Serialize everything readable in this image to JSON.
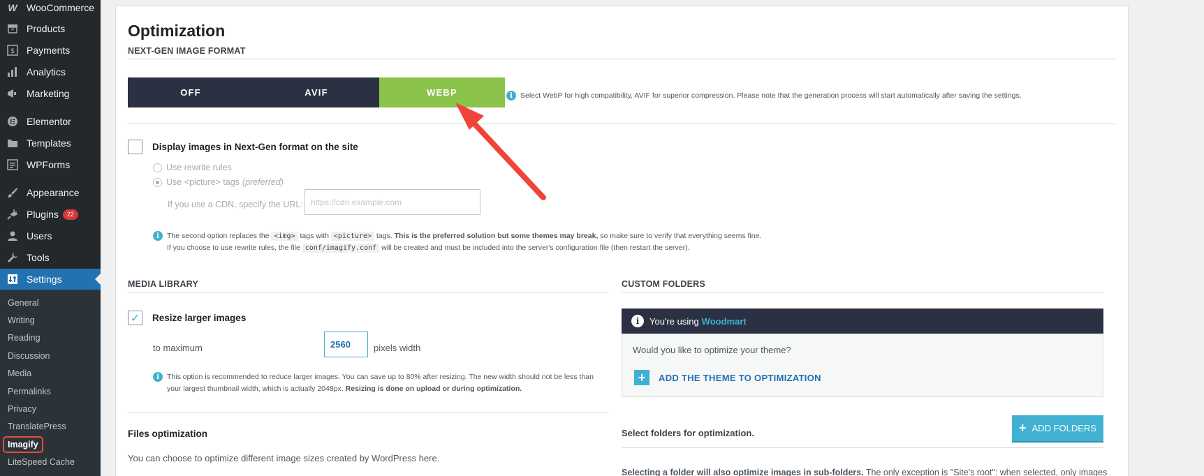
{
  "sidebar": {
    "items": [
      {
        "label": "WooCommerce",
        "icon": "woo-icon",
        "badge": ""
      },
      {
        "label": "Products",
        "icon": "archive-icon",
        "badge": ""
      },
      {
        "label": "Payments",
        "icon": "dollar-icon",
        "badge": ""
      },
      {
        "label": "Analytics",
        "icon": "bar-chart-icon",
        "badge": ""
      },
      {
        "label": "Marketing",
        "icon": "megaphone-icon",
        "badge": ""
      },
      {
        "label": "Elementor",
        "icon": "elementor-icon",
        "badge": ""
      },
      {
        "label": "Templates",
        "icon": "folder-icon",
        "badge": ""
      },
      {
        "label": "WPForms",
        "icon": "forms-icon",
        "badge": ""
      },
      {
        "label": "Appearance",
        "icon": "brush-icon",
        "badge": ""
      },
      {
        "label": "Plugins",
        "icon": "plug-icon",
        "badge": "22"
      },
      {
        "label": "Users",
        "icon": "user-icon",
        "badge": ""
      },
      {
        "label": "Tools",
        "icon": "wrench-icon",
        "badge": ""
      },
      {
        "label": "Settings",
        "icon": "settings-icon",
        "badge": ""
      }
    ],
    "submenu": [
      "General",
      "Writing",
      "Reading",
      "Discussion",
      "Media",
      "Permalinks",
      "Privacy",
      "TranslatePress",
      "Imagify",
      "LiteSpeed Cache"
    ]
  },
  "page": {
    "title": "Optimization",
    "nextgen_label": "NEXT-GEN IMAGE FORMAT",
    "format_options": [
      "OFF",
      "AVIF",
      "WEBP"
    ],
    "format_selected": "WEBP",
    "format_help": "Select WebP for high compatibility, AVIF for superior compression. Please note that the generation process will start automatically after saving the settings.",
    "display_nextgen_label": "Display images in Next-Gen format on the site",
    "rewrite_rules_label": "Use rewrite rules",
    "picture_tags_label": "Use <picture> tags",
    "picture_tags_pref": "(preferred)",
    "cdn_label": "If you use a CDN, specify the URL:",
    "cdn_placeholder": "https://cdn.example.com",
    "note1_a": "The second option replaces the",
    "note1_code1": "<img>",
    "note1_b": "tags with",
    "note1_code2": "<picture>",
    "note1_c": "tags.",
    "note1_bold": "This is the preferred solution but some themes may break,",
    "note1_d": "so make sure to verify that everything seems fine.",
    "note2_a": "If you choose to use rewrite rules, the file",
    "note2_code": "conf/imagify.conf",
    "note2_b": "will be created and must be included into the server's configuration file (then restart the server)."
  },
  "media_library": {
    "label": "MEDIA LIBRARY",
    "resize_label": "Resize larger images",
    "resize_checked": true,
    "to_max_label": "to maximum",
    "max_width": "2560",
    "pixels_label": "pixels width",
    "note_a": "This option is recommended to reduce larger images. You can save up to 80% after resizing. The new width should not be less than your largest thumbnail width, which is actually 2048px.",
    "note_bold": "Resizing is done on upload or during optimization.",
    "files_opt_title": "Files optimization",
    "files_opt_desc": "You can choose to optimize different image sizes created by WordPress here."
  },
  "custom_folders": {
    "label": "CUSTOM FOLDERS",
    "using_label": "You're using",
    "theme_name": "Woodmart",
    "question": "Would you like to optimize your theme?",
    "add_theme_label": "ADD THE THEME TO OPTIMIZATION",
    "select_folders_label": "Select folders for optimization.",
    "add_folders_label": "ADD FOLDERS",
    "bottom_bold": "Selecting a folder will also optimize images in sub-folders.",
    "bottom_text": "The only exception is \"Site's root\": when selected, only images"
  },
  "colors": {
    "accent": "#40b1d0",
    "active_format": "#8bc34a",
    "dark": "#2b3142",
    "arrow": "#f0443a"
  }
}
